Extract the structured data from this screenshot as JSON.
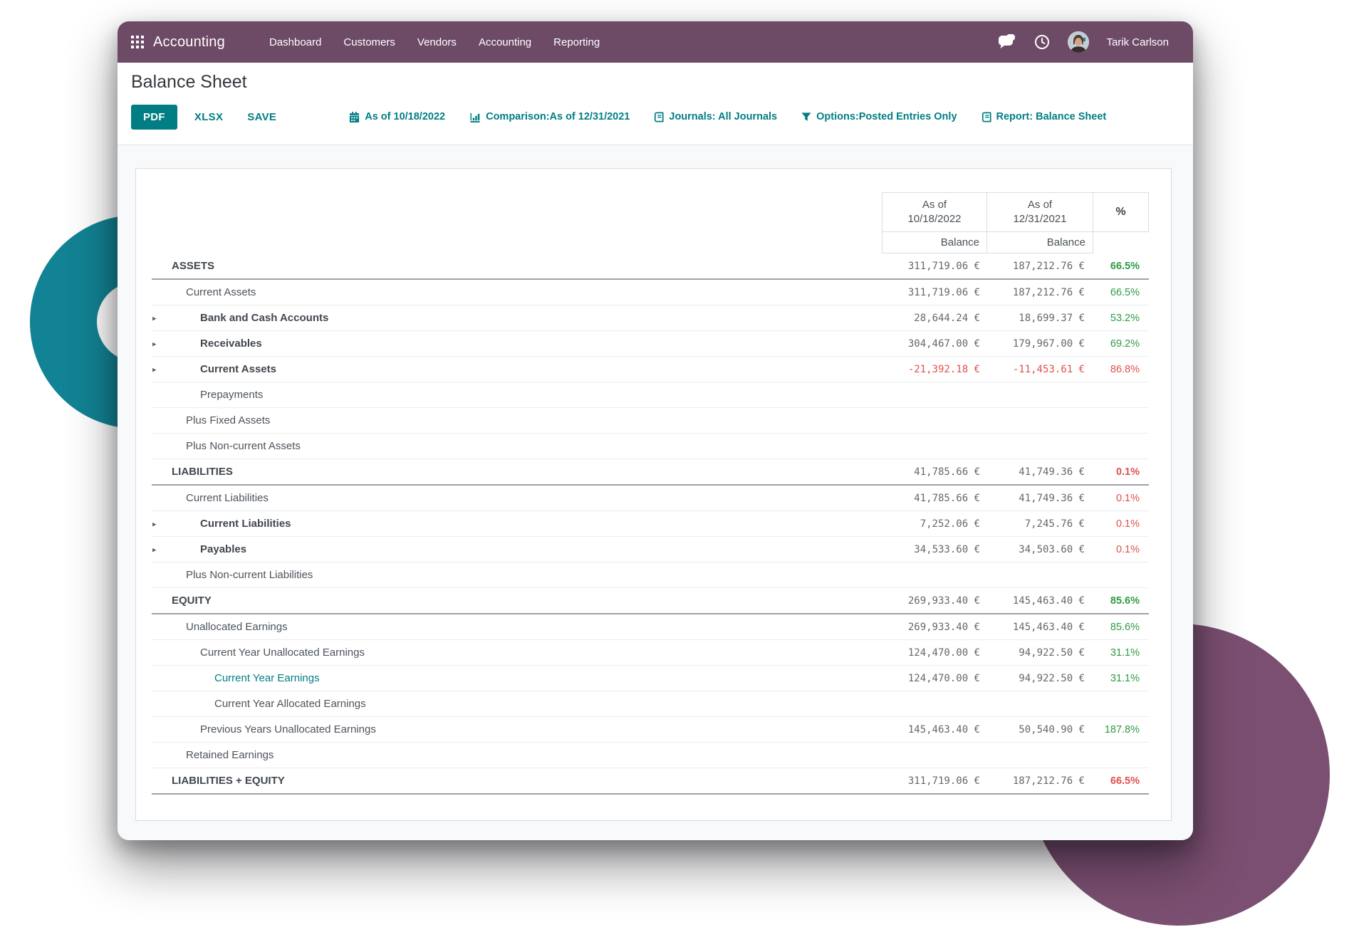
{
  "navbar": {
    "brand": "Accounting",
    "menu_items": [
      "Dashboard",
      "Customers",
      "Vendors",
      "Accounting",
      "Reporting"
    ],
    "user_name": "Tarik Carlson"
  },
  "report": {
    "title": "Balance Sheet",
    "export_buttons": [
      {
        "label": "PDF",
        "primary": true
      },
      {
        "label": "XLSX",
        "primary": false
      },
      {
        "label": "SAVE",
        "primary": false
      }
    ],
    "filters": [
      {
        "icon": "calendar-icon",
        "label": "As of 10/18/2022"
      },
      {
        "icon": "comparison-icon",
        "label": "Comparison:As of 12/31/2021"
      },
      {
        "icon": "journals-icon",
        "label": "Journals: All Journals"
      },
      {
        "icon": "options-icon",
        "label": "Options:Posted Entries Only"
      },
      {
        "icon": "report-icon",
        "label": "Report: Balance Sheet"
      }
    ]
  },
  "table": {
    "period1": {
      "line1": "As of",
      "line2": "10/18/2022",
      "sub": "Balance"
    },
    "period2": {
      "line1": "As of",
      "line2": "12/31/2021",
      "sub": "Balance"
    },
    "pct_header": "%",
    "rows": [
      {
        "label": "ASSETS",
        "level": 0,
        "bold": true,
        "caret": false,
        "link": false,
        "v1": "311,719.06 €",
        "v2": "187,212.76 €",
        "pct": "66.5%",
        "pct_color": "green",
        "pct_bold": true,
        "sep": "thick"
      },
      {
        "label": "Current Assets",
        "level": 1,
        "bold": false,
        "caret": false,
        "link": false,
        "v1": "311,719.06 €",
        "v2": "187,212.76 €",
        "pct": "66.5%",
        "pct_color": "green",
        "pct_bold": false,
        "sep": "light"
      },
      {
        "label": "Bank and Cash Accounts",
        "level": 2,
        "bold": true,
        "caret": true,
        "link": false,
        "v1": "28,644.24 €",
        "v2": "18,699.37 €",
        "pct": "53.2%",
        "pct_color": "green",
        "pct_bold": false,
        "sep": "light"
      },
      {
        "label": "Receivables",
        "level": 2,
        "bold": true,
        "caret": true,
        "link": false,
        "v1": "304,467.00 €",
        "v2": "179,967.00 €",
        "pct": "69.2%",
        "pct_color": "green",
        "pct_bold": false,
        "sep": "light"
      },
      {
        "label": "Current Assets",
        "level": 2,
        "bold": true,
        "caret": true,
        "link": false,
        "v1": "-21,392.18 €",
        "v2": "-11,453.61 €",
        "pct": "86.8%",
        "pct_color": "red",
        "pct_bold": false,
        "sep": "light"
      },
      {
        "label": "Prepayments",
        "level": 2,
        "bold": false,
        "caret": false,
        "link": false,
        "v1": "",
        "v2": "",
        "pct": "",
        "pct_color": "",
        "pct_bold": false,
        "sep": "light"
      },
      {
        "label": "Plus Fixed Assets",
        "level": 1,
        "bold": false,
        "caret": false,
        "link": false,
        "v1": "",
        "v2": "",
        "pct": "",
        "pct_color": "",
        "pct_bold": false,
        "sep": "light"
      },
      {
        "label": "Plus Non-current Assets",
        "level": 1,
        "bold": false,
        "caret": false,
        "link": false,
        "v1": "",
        "v2": "",
        "pct": "",
        "pct_color": "",
        "pct_bold": false,
        "sep": "light"
      },
      {
        "label": "LIABILITIES",
        "level": 0,
        "bold": true,
        "caret": false,
        "link": false,
        "v1": "41,785.66 €",
        "v2": "41,749.36 €",
        "pct": "0.1%",
        "pct_color": "red",
        "pct_bold": true,
        "sep": "thick"
      },
      {
        "label": "Current Liabilities",
        "level": 1,
        "bold": false,
        "caret": false,
        "link": false,
        "v1": "41,785.66 €",
        "v2": "41,749.36 €",
        "pct": "0.1%",
        "pct_color": "red",
        "pct_bold": false,
        "sep": "light"
      },
      {
        "label": "Current Liabilities",
        "level": 2,
        "bold": true,
        "caret": true,
        "link": false,
        "v1": "7,252.06 €",
        "v2": "7,245.76 €",
        "pct": "0.1%",
        "pct_color": "red",
        "pct_bold": false,
        "sep": "light"
      },
      {
        "label": "Payables",
        "level": 2,
        "bold": true,
        "caret": true,
        "link": false,
        "v1": "34,533.60 €",
        "v2": "34,503.60 €",
        "pct": "0.1%",
        "pct_color": "red",
        "pct_bold": false,
        "sep": "light"
      },
      {
        "label": "Plus Non-current Liabilities",
        "level": 1,
        "bold": false,
        "caret": false,
        "link": false,
        "v1": "",
        "v2": "",
        "pct": "",
        "pct_color": "",
        "pct_bold": false,
        "sep": "light"
      },
      {
        "label": "EQUITY",
        "level": 0,
        "bold": true,
        "caret": false,
        "link": false,
        "v1": "269,933.40 €",
        "v2": "145,463.40 €",
        "pct": "85.6%",
        "pct_color": "green",
        "pct_bold": true,
        "sep": "thick"
      },
      {
        "label": "Unallocated Earnings",
        "level": 1,
        "bold": false,
        "caret": false,
        "link": false,
        "v1": "269,933.40 €",
        "v2": "145,463.40 €",
        "pct": "85.6%",
        "pct_color": "green",
        "pct_bold": false,
        "sep": "light"
      },
      {
        "label": "Current Year Unallocated Earnings",
        "level": 2,
        "bold": false,
        "caret": false,
        "link": false,
        "v1": "124,470.00 €",
        "v2": "94,922.50 €",
        "pct": "31.1%",
        "pct_color": "green",
        "pct_bold": false,
        "sep": "light"
      },
      {
        "label": "Current Year Earnings",
        "level": 3,
        "bold": false,
        "caret": false,
        "link": true,
        "v1": "124,470.00 €",
        "v2": "94,922.50 €",
        "pct": "31.1%",
        "pct_color": "green",
        "pct_bold": false,
        "sep": "light"
      },
      {
        "label": "Current Year Allocated Earnings",
        "level": 3,
        "bold": false,
        "caret": false,
        "link": false,
        "v1": "",
        "v2": "",
        "pct": "",
        "pct_color": "",
        "pct_bold": false,
        "sep": "light"
      },
      {
        "label": "Previous Years Unallocated Earnings",
        "level": 2,
        "bold": false,
        "caret": false,
        "link": false,
        "v1": "145,463.40 €",
        "v2": "50,540.90 €",
        "pct": "187.8%",
        "pct_color": "green",
        "pct_bold": false,
        "sep": "light"
      },
      {
        "label": "Retained Earnings",
        "level": 1,
        "bold": false,
        "caret": false,
        "link": false,
        "v1": "",
        "v2": "",
        "pct": "",
        "pct_color": "",
        "pct_bold": false,
        "sep": "light"
      },
      {
        "label": "LIABILITIES + EQUITY",
        "level": 0,
        "bold": true,
        "caret": false,
        "link": false,
        "v1": "311,719.06 €",
        "v2": "187,212.76 €",
        "pct": "66.5%",
        "pct_color": "red",
        "pct_bold": true,
        "sep": "thick"
      }
    ]
  },
  "colors": {
    "navbar_purple": "#6d4a66",
    "accent_teal": "#017e84",
    "positive_green": "#2f9b44",
    "negative_red": "#e0514d",
    "shape_teal": "#128394",
    "shape_purple": "#7b4f71"
  }
}
